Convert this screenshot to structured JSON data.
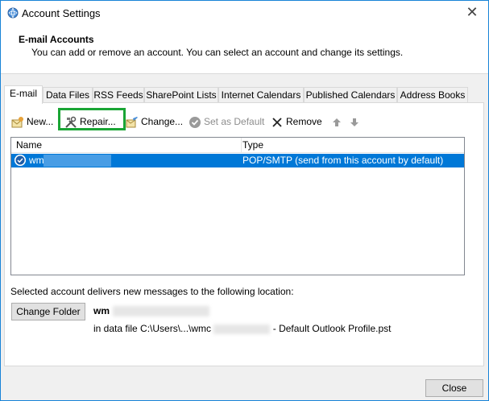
{
  "window": {
    "title": "Account Settings"
  },
  "header": {
    "title": "E-mail Accounts",
    "subtitle": "You can add or remove an account. You can select an account and change its settings."
  },
  "tabs": [
    {
      "label": "E-mail",
      "active": true
    },
    {
      "label": "Data Files"
    },
    {
      "label": "RSS Feeds"
    },
    {
      "label": "SharePoint Lists"
    },
    {
      "label": "Internet Calendars"
    },
    {
      "label": "Published Calendars"
    },
    {
      "label": "Address Books"
    }
  ],
  "toolbar": {
    "new_label": "New...",
    "repair_label": "Repair...",
    "change_label": "Change...",
    "set_default_label": "Set as Default",
    "remove_label": "Remove"
  },
  "list": {
    "columns": [
      "Name",
      "Type"
    ],
    "rows": [
      {
        "name": "wm",
        "type": "POP/SMTP (send from this account by default)",
        "selected": true
      }
    ]
  },
  "delivery": {
    "label": "Selected account delivers new messages to the following location:",
    "change_folder_label": "Change Folder",
    "account_name": "wm",
    "data_file_prefix": "in data file C:\\Users\\...\\wmc",
    "data_file_suffix": "- Default Outlook Profile.pst"
  },
  "footer": {
    "close_label": "Close"
  },
  "colors": {
    "selection": "#0078d7",
    "highlight_box": "#1aa535",
    "window_border": "#1883d7"
  }
}
